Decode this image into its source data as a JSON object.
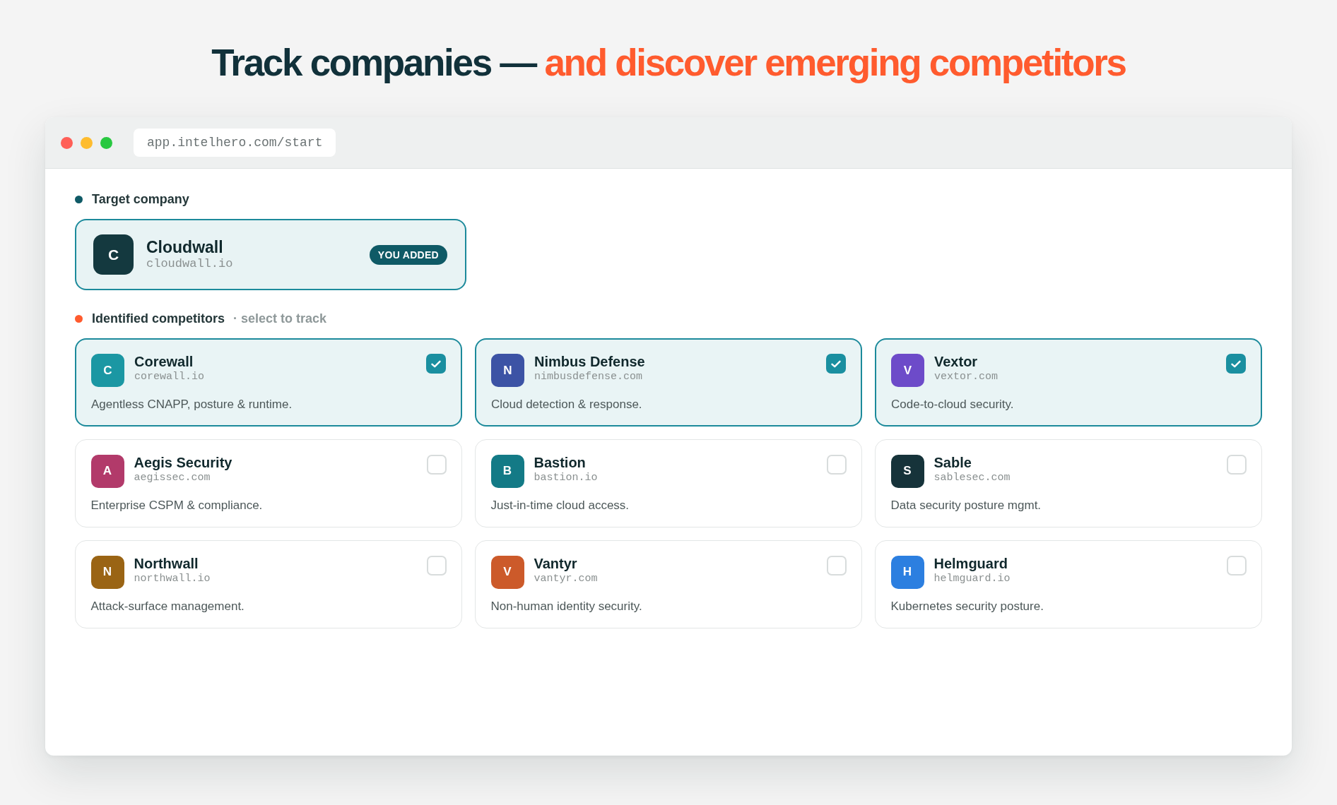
{
  "headline": {
    "text": "Track companies —",
    "accent": "and discover emerging competitors"
  },
  "browser": {
    "url": "app.intelhero.com/start"
  },
  "target": {
    "label": "Target company",
    "company": {
      "letter": "C",
      "name": "Cloudwall",
      "domain": "cloudwall.io",
      "color": "#14393f",
      "badge": "YOU ADDED"
    }
  },
  "competitors": {
    "label": "Identified competitors",
    "hint": "· select to track",
    "items": [
      {
        "letter": "C",
        "name": "Corewall",
        "domain": "corewall.io",
        "description": "Agentless CNAPP, posture & runtime.",
        "color": "#1b97a3",
        "selected": true
      },
      {
        "letter": "N",
        "name": "Nimbus Defense",
        "domain": "nimbusdefense.com",
        "description": "Cloud detection & response.",
        "color": "#3c53a5",
        "selected": true
      },
      {
        "letter": "V",
        "name": "Vextor",
        "domain": "vextor.com",
        "description": "Code-to-cloud security.",
        "color": "#6d4bc9",
        "selected": true
      },
      {
        "letter": "A",
        "name": "Aegis Security",
        "domain": "aegissec.com",
        "description": "Enterprise CSPM & compliance.",
        "color": "#b23a6a",
        "selected": false
      },
      {
        "letter": "B",
        "name": "Bastion",
        "domain": "bastion.io",
        "description": "Just-in-time cloud access.",
        "color": "#137a86",
        "selected": false
      },
      {
        "letter": "S",
        "name": "Sable",
        "domain": "sablesec.com",
        "description": "Data security posture mgmt.",
        "color": "#16333a",
        "selected": false
      },
      {
        "letter": "N",
        "name": "Northwall",
        "domain": "northwall.io",
        "description": "Attack-surface management.",
        "color": "#9a6414",
        "selected": false
      },
      {
        "letter": "V",
        "name": "Vantyr",
        "domain": "vantyr.com",
        "description": "Non-human identity security.",
        "color": "#cc5a2a",
        "selected": false
      },
      {
        "letter": "H",
        "name": "Helmguard",
        "domain": "helmguard.io",
        "description": "Kubernetes security posture.",
        "color": "#2c7fe0",
        "selected": false
      }
    ]
  }
}
